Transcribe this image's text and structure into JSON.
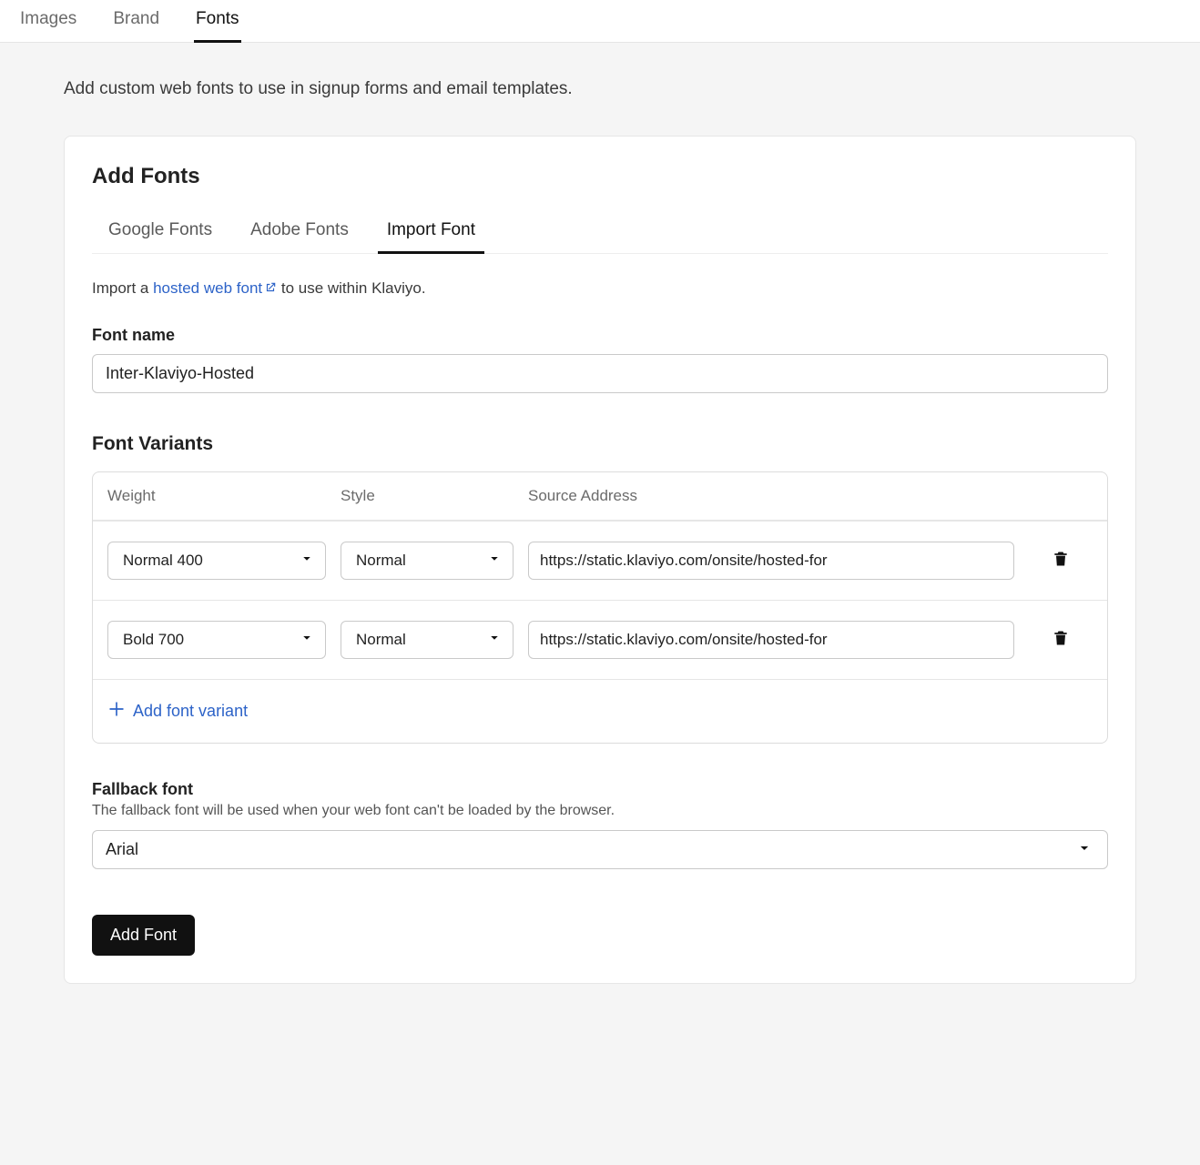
{
  "topTabs": {
    "images": "Images",
    "brand": "Brand",
    "fonts": "Fonts"
  },
  "intro": "Add custom web fonts to use in signup forms and email templates.",
  "card": {
    "title": "Add Fonts",
    "subTabs": {
      "google": "Google Fonts",
      "adobe": "Adobe Fonts",
      "import": "Import Font"
    },
    "importLine": {
      "prefix": "Import a ",
      "linkText": "hosted web font",
      "suffix": " to use within Klaviyo."
    },
    "fontNameLabel": "Font name",
    "fontNameValue": "Inter-Klaviyo-Hosted",
    "variantsHeading": "Font Variants",
    "columns": {
      "weight": "Weight",
      "style": "Style",
      "source": "Source Address"
    },
    "variants": [
      {
        "weight": "Normal 400",
        "style": "Normal",
        "source": "https://static.klaviyo.com/onsite/hosted-for"
      },
      {
        "weight": "Bold 700",
        "style": "Normal",
        "source": "https://static.klaviyo.com/onsite/hosted-for"
      }
    ],
    "addVariantLabel": "Add font variant",
    "fallback": {
      "label": "Fallback font",
      "help": "The fallback font will be used when your web font can't be loaded by the browser.",
      "value": "Arial"
    },
    "submitLabel": "Add Font"
  }
}
